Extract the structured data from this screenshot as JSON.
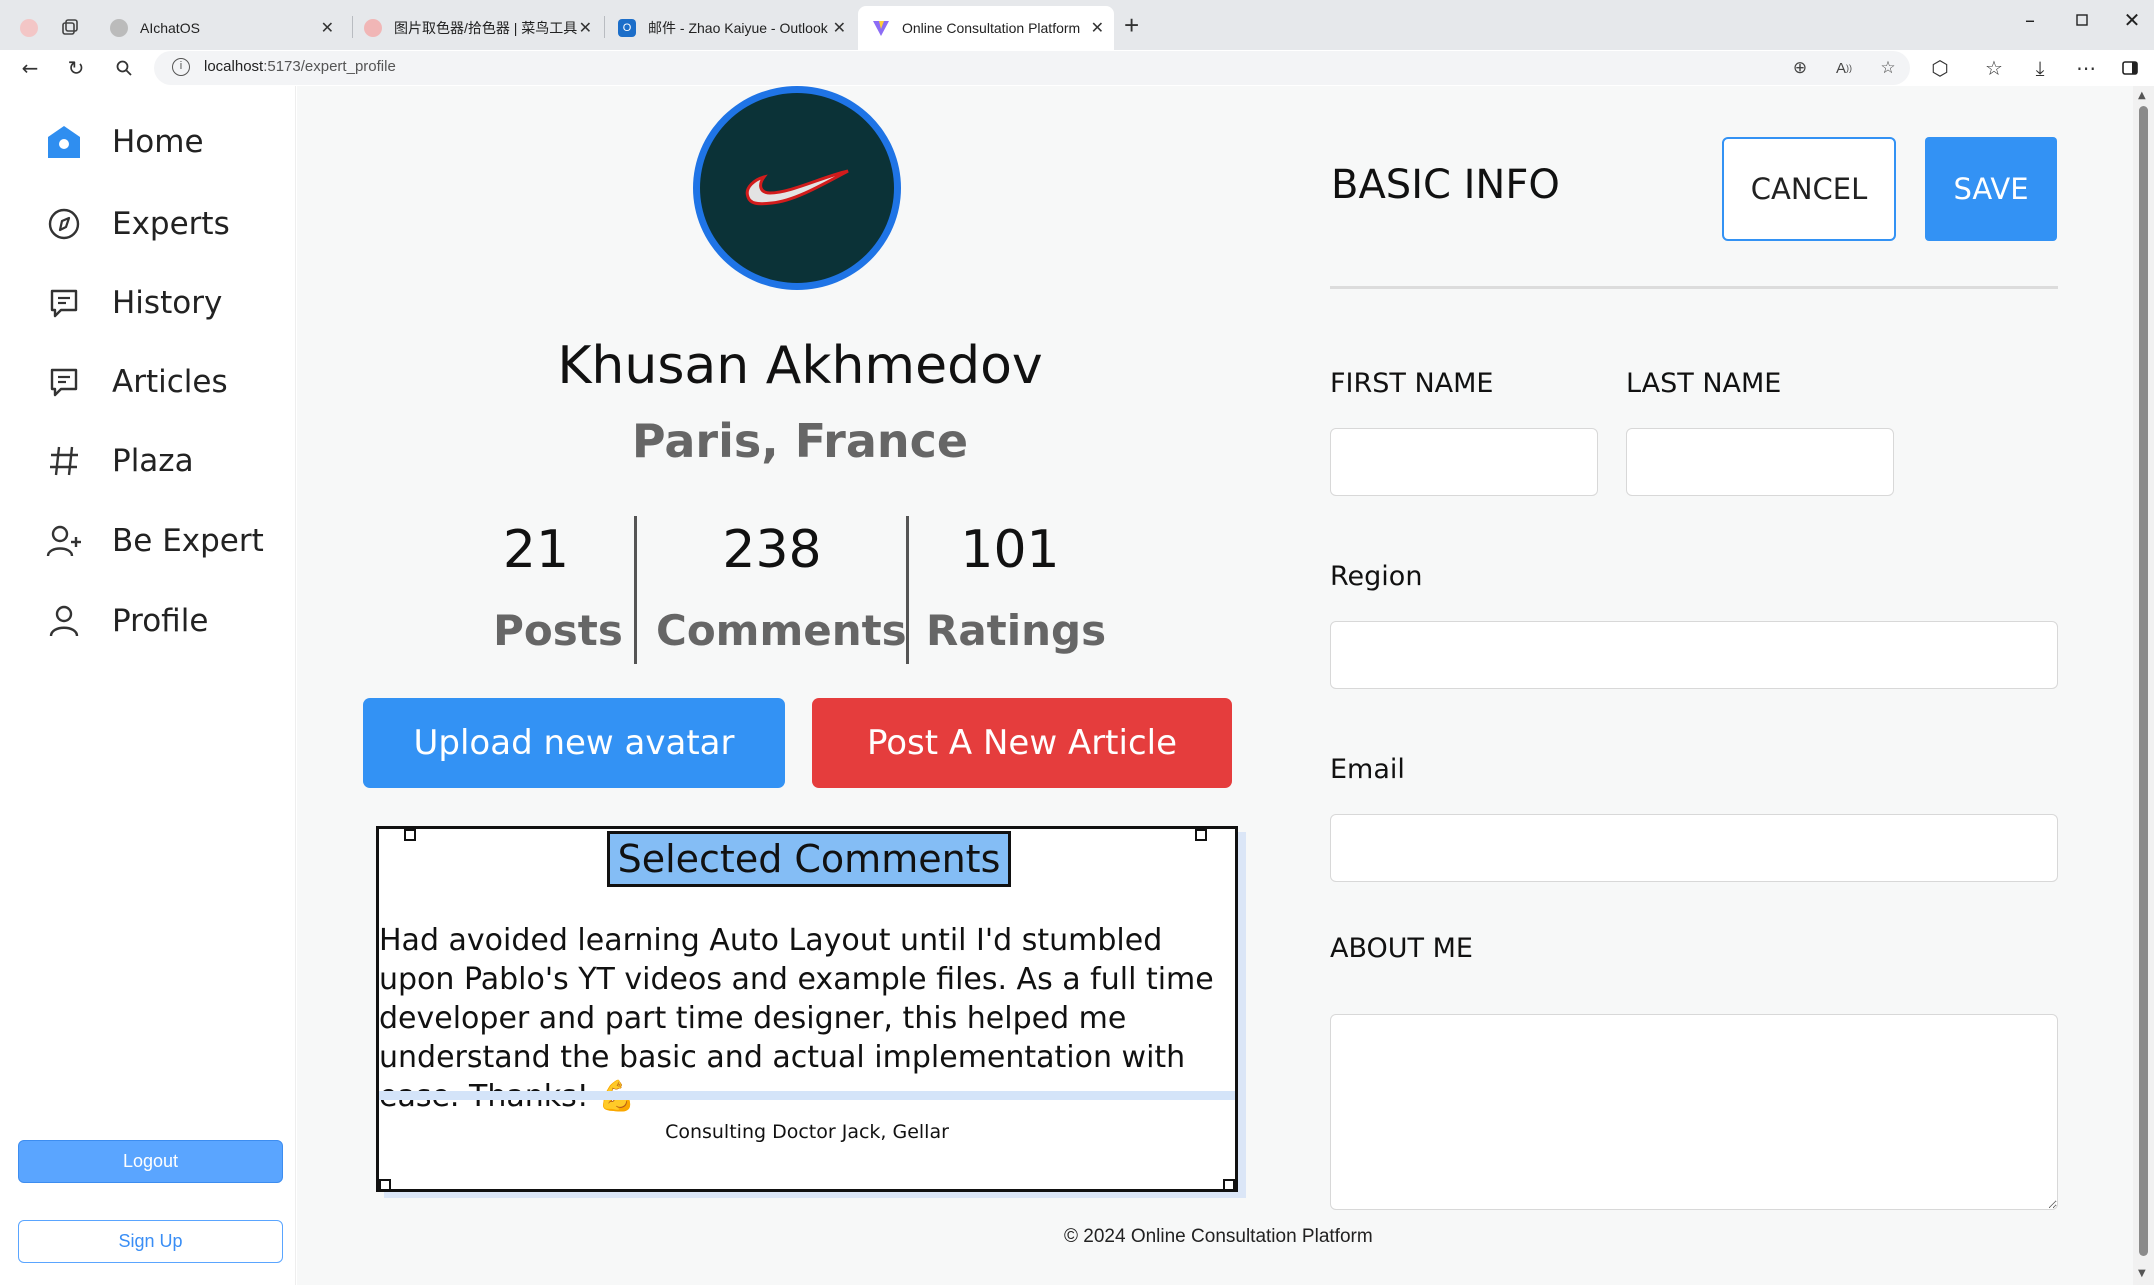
{
  "browser": {
    "tabs": [
      {
        "title": "AIchatOS",
        "active": false
      },
      {
        "title": "图片取色器/拾色器 | 菜鸟工具",
        "active": false
      },
      {
        "title": "邮件 - Zhao Kaiyue - Outlook",
        "active": false
      },
      {
        "title": "Online Consultation Platform",
        "active": true
      }
    ],
    "url_host": "localhost",
    "url_path": ":5173/expert_profile"
  },
  "sidebar": {
    "items": [
      {
        "label": "Home",
        "icon": "home-icon",
        "active": true
      },
      {
        "label": "Experts",
        "icon": "compass-icon"
      },
      {
        "label": "History",
        "icon": "chat-icon"
      },
      {
        "label": "Articles",
        "icon": "chat-icon"
      },
      {
        "label": "Plaza",
        "icon": "hash-icon"
      },
      {
        "label": "Be Expert",
        "icon": "user-add-icon"
      },
      {
        "label": "Profile",
        "icon": "user-icon"
      }
    ],
    "logout_label": "Logout",
    "signup_label": "Sign Up",
    "accent_color": "#3392f4"
  },
  "profile": {
    "name": "Khusan Akhmedov",
    "location": "Paris, France",
    "stats": [
      {
        "value": "21",
        "label": "Posts"
      },
      {
        "value": "238",
        "label": "Comments"
      },
      {
        "value": "101",
        "label": "Ratings"
      }
    ],
    "upload_label": "Upload new avatar",
    "post_label": "Post A New Article"
  },
  "comments": {
    "title": "Selected Comments",
    "text": "Had avoided learning Auto Layout until I'd stumbled upon Pablo's YT videos and example files. As a full time developer and part time designer, this helped me understand the basic and actual implementation with ease. Thanks! 💪",
    "author": "Consulting Doctor Jack, Gellar"
  },
  "form": {
    "title": "BASIC INFO",
    "cancel_label": "CANCEL",
    "save_label": "SAVE",
    "first_name_label": "FIRST NAME",
    "first_name_value": "",
    "last_name_label": "LAST NAME",
    "last_name_value": "",
    "region_label": "Region",
    "region_value": "",
    "email_label": "Email",
    "email_value": "",
    "about_label": "ABOUT ME",
    "about_value": ""
  },
  "footer": "© 2024 Online Consultation Platform",
  "colors": {
    "primary": "#3392f4",
    "danger": "#e53d3d",
    "card_title_bg": "#84bdf5",
    "avatar_ring": "#1f74e6"
  }
}
